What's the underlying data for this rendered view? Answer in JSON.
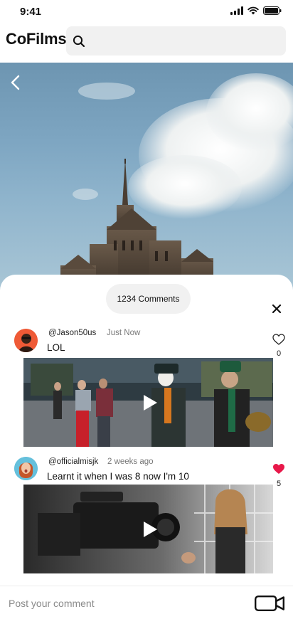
{
  "status_bar": {
    "time": "9:41"
  },
  "header": {
    "app_title": "CoFilms"
  },
  "comments_panel": {
    "count_label": "1234 Comments",
    "comments": [
      {
        "handle": "@Jason50us",
        "time": "Just Now",
        "text": "LOL",
        "likes": "0",
        "liked": false
      },
      {
        "handle": "@officialmisjk",
        "time": "2 weeks ago",
        "text": "Learnt it when I was 8 now I'm 10",
        "likes": "5",
        "liked": true
      }
    ]
  },
  "composer": {
    "placeholder": "Post your comment"
  },
  "colors": {
    "like_active": "#e8184a",
    "pill_bg": "#f1f1f1",
    "search_bg": "#f1f1f1"
  },
  "icons": [
    "signal-icon",
    "wifi-icon",
    "battery-icon",
    "search-icon",
    "back-icon",
    "close-icon",
    "heart-icon",
    "play-icon",
    "video-camera-icon"
  ]
}
